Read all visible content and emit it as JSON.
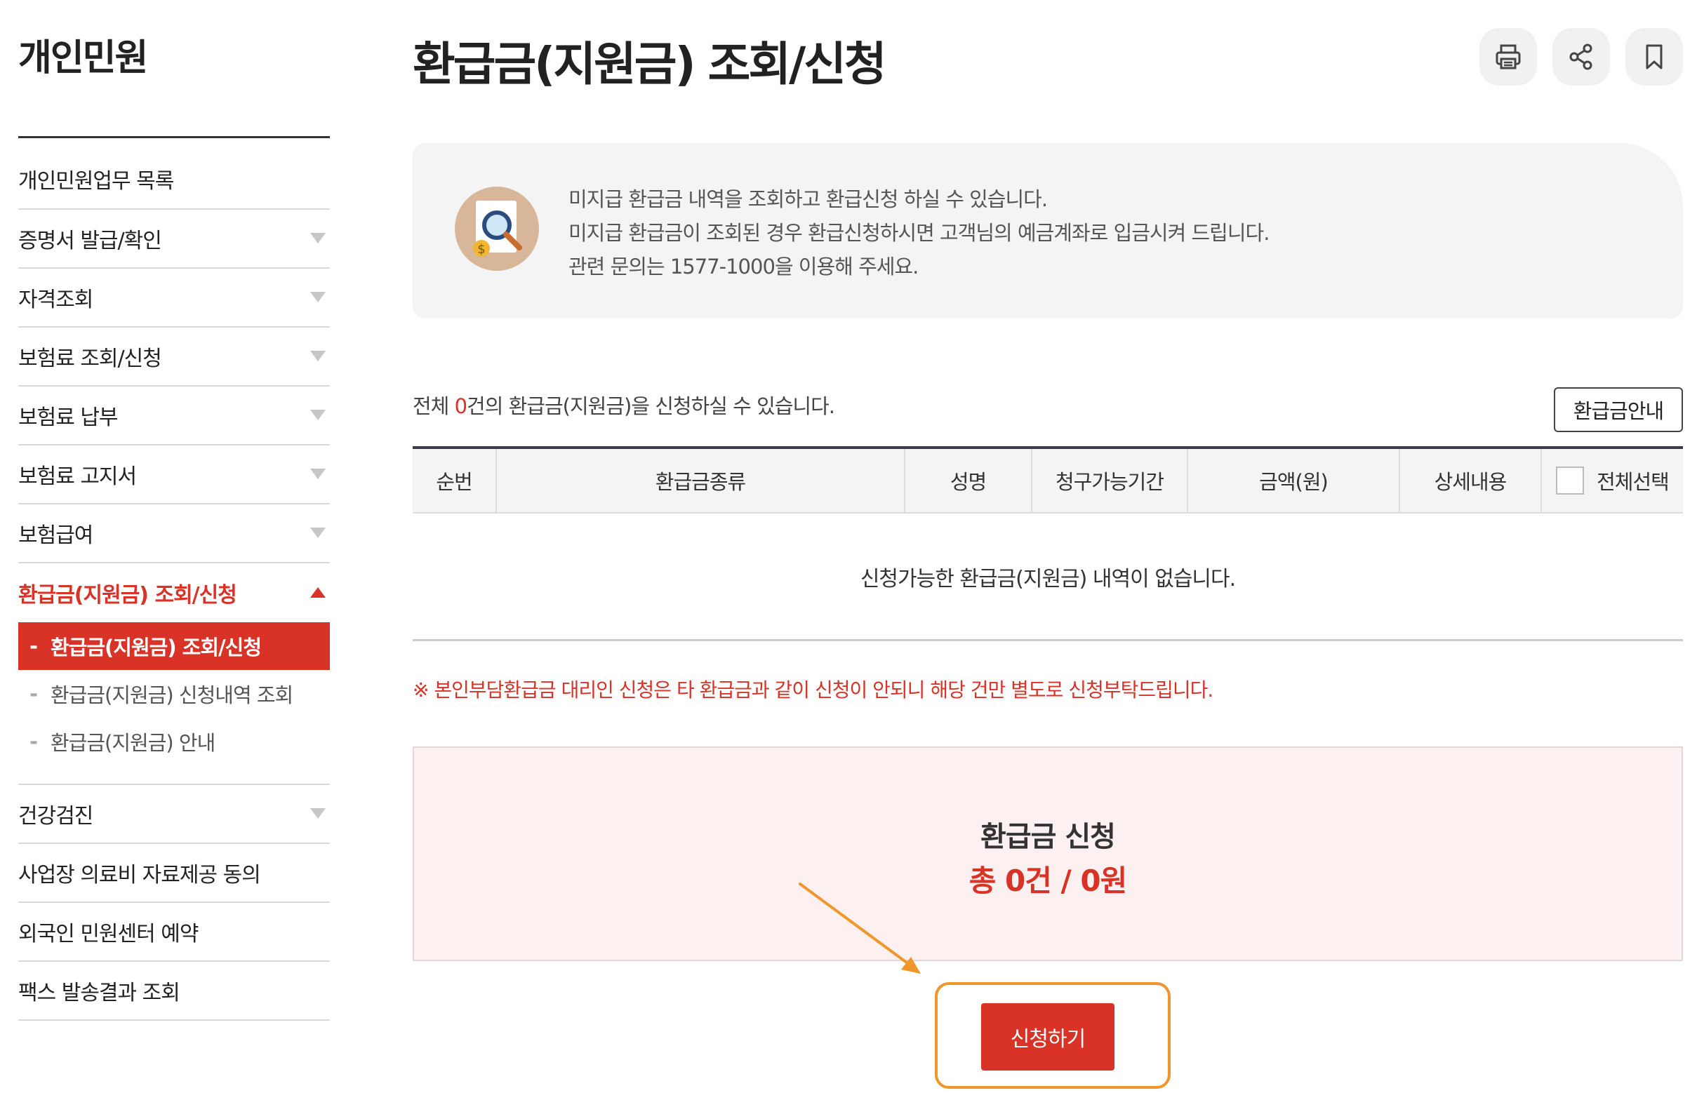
{
  "sidebar": {
    "title": "개인민원",
    "items": [
      {
        "label": "개인민원업무 목록",
        "has_caret": false
      },
      {
        "label": "증명서 발급/확인",
        "has_caret": true
      },
      {
        "label": "자격조회",
        "has_caret": true
      },
      {
        "label": "보험료 조회/신청",
        "has_caret": true
      },
      {
        "label": "보험료 납부",
        "has_caret": true
      },
      {
        "label": "보험료 고지서",
        "has_caret": true
      },
      {
        "label": "보험급여",
        "has_caret": true
      },
      {
        "label": "환급금(지원금) 조회/신청",
        "has_caret": true,
        "active": true
      },
      {
        "label": "건강검진",
        "has_caret": true
      },
      {
        "label": "사업장 의료비 자료제공 동의",
        "has_caret": false
      },
      {
        "label": "외국인 민원센터 예약",
        "has_caret": false
      },
      {
        "label": "팩스 발송결과 조회",
        "has_caret": false
      }
    ],
    "submenu": [
      {
        "label": "환급금(지원금) 조회/신청",
        "current": true
      },
      {
        "label": "환급금(지원금) 신청내역 조회",
        "current": false
      },
      {
        "label": "환급금(지원금) 안내",
        "current": false
      }
    ]
  },
  "header": {
    "title": "환급금(지원금) 조회/신청",
    "tools": [
      {
        "icon": "print-icon"
      },
      {
        "icon": "share-icon"
      },
      {
        "icon": "bookmark-icon"
      }
    ]
  },
  "info": {
    "icon": "search-document-icon",
    "lines": [
      "미지급 환급금 내역을 조회하고 환급신청 하실 수 있습니다.",
      "미지급 환급금이 조회된 경우 환급신청하시면 고객님의 예금계좌로 입금시켜 드립니다.",
      "관련 문의는 1577-1000을 이용해 주세요."
    ]
  },
  "count": {
    "prefix": "전체 ",
    "number": "0",
    "suffix": "건의 환급금(지원금)을 신청하실 수 있습니다."
  },
  "guide_button": "환급금안내",
  "table": {
    "headers": [
      "순번",
      "환급금종류",
      "성명",
      "청구가능기간",
      "금액(원)",
      "상세내용",
      "전체선택"
    ],
    "empty_message": "신청가능한 환급금(지원금) 내역이 없습니다."
  },
  "notice": "※ 본인부담환급금 대리인 신청은 타 환급금과 같이 신청이 안되니 해당 건만 별도로 신청부탁드립니다.",
  "summary": {
    "title": "환급금 신청",
    "total": "총 0건 / 0원"
  },
  "apply_button": "신청하기",
  "colors": {
    "accent": "#d93226",
    "highlight": "#f0962a",
    "info_bg": "#f4f4f4",
    "summary_bg": "#fcf1f0"
  }
}
